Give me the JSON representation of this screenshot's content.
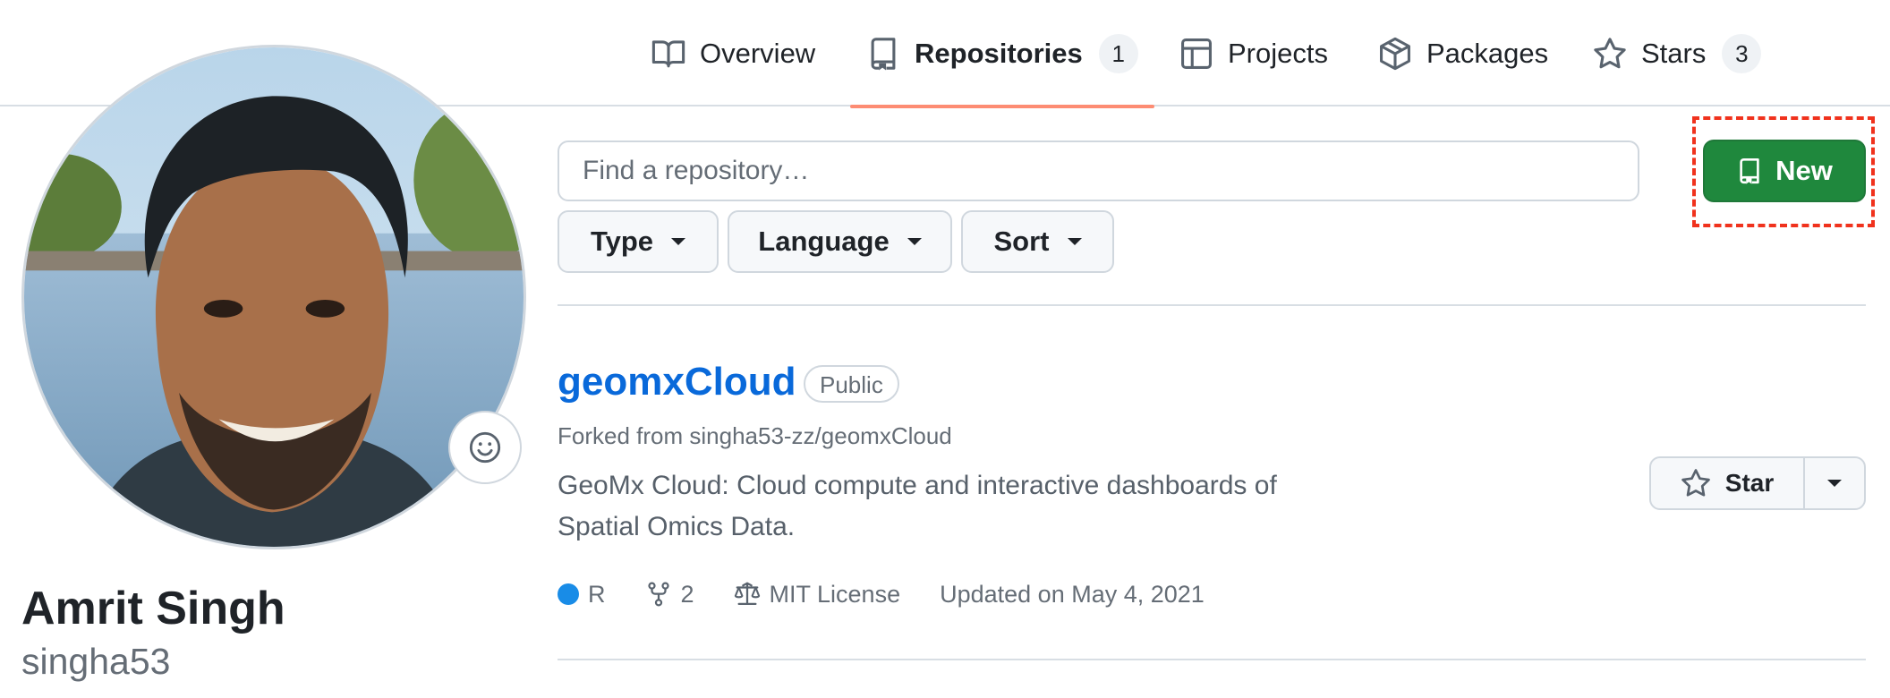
{
  "tabs": [
    {
      "label": "Overview",
      "icon": "book-icon"
    },
    {
      "label": "Repositories",
      "icon": "repo-icon",
      "count": "1",
      "selected": true
    },
    {
      "label": "Projects",
      "icon": "table-icon"
    },
    {
      "label": "Packages",
      "icon": "package-icon"
    },
    {
      "label": "Stars",
      "icon": "star-icon",
      "count": "3"
    }
  ],
  "profile": {
    "name": "Amrit Singh",
    "username": "singha53"
  },
  "filters": {
    "search_placeholder": "Find a repository…",
    "type_label": "Type",
    "language_label": "Language",
    "sort_label": "Sort",
    "new_label": "New"
  },
  "repo": {
    "name": "geomxCloud",
    "visibility": "Public",
    "forked_from": "Forked from singha53-zz/geomxCloud",
    "description": "GeoMx Cloud: Cloud compute and interactive dashboards of Spatial Omics Data.",
    "language": "R",
    "language_color": "#198CE7",
    "forks": "2",
    "license": "MIT License",
    "updated": "Updated on May 4, 2021",
    "star_label": "Star"
  },
  "colors": {
    "accent_underline": "#fd8c73",
    "primary_button": "#1f883d",
    "link": "#0969da",
    "highlight_outline": "#f0321d"
  }
}
